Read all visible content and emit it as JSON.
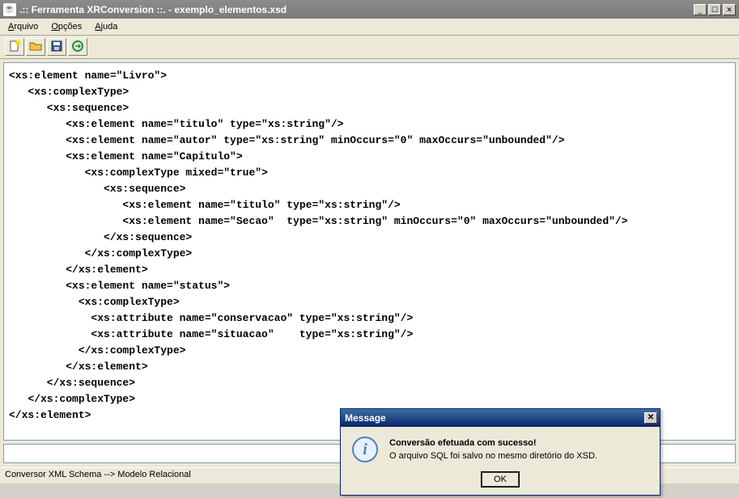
{
  "window": {
    "title": ".:: Ferramenta XRConversion ::. - exemplo_elementos.xsd",
    "java_icon_label": "☕"
  },
  "window_controls": {
    "minimize": "_",
    "maximize": "☐",
    "close": "✕"
  },
  "menubar": {
    "arquivo": "Arquivo",
    "arquivo_u": "A",
    "opcoes": "Opções",
    "opcoes_u": "O",
    "ajuda": "Ajuda",
    "ajuda_u": "A"
  },
  "toolbar": {
    "new_name": "new-file-icon",
    "open_name": "open-file-icon",
    "save_name": "save-file-icon",
    "convert_name": "convert-icon"
  },
  "code_lines": [
    "<xs:element name=\"Livro\">",
    "   <xs:complexType>",
    "      <xs:sequence>",
    "         <xs:element name=\"titulo\" type=\"xs:string\"/>",
    "         <xs:element name=\"autor\" type=\"xs:string\" minOccurs=\"0\" maxOccurs=\"unbounded\"/>",
    "         <xs:element name=\"Capitulo\">",
    "            <xs:complexType mixed=\"true\">",
    "               <xs:sequence>",
    "                  <xs:element name=\"titulo\" type=\"xs:string\"/>",
    "                  <xs:element name=\"Secao\"  type=\"xs:string\" minOccurs=\"0\" maxOccurs=\"unbounded\"/>",
    "               </xs:sequence>",
    "            </xs:complexType>",
    "         </xs:element>",
    "         <xs:element name=\"status\">",
    "           <xs:complexType>",
    "             <xs:attribute name=\"conservacao\" type=\"xs:string\"/>",
    "             <xs:attribute name=\"situacao\"    type=\"xs:string\"/>",
    "           </xs:complexType>",
    "         </xs:element>",
    "      </xs:sequence>",
    "   </xs:complexType>",
    "</xs:element>"
  ],
  "dialog": {
    "title": "Message",
    "close": "✕",
    "line1": "Conversão efetuada com sucesso!",
    "line2": "O arquivo SQL foi salvo no mesmo diretório do XSD.",
    "ok": "OK"
  },
  "statusbar": {
    "text": "Conversor XML Schema --> Modelo Relacional"
  }
}
